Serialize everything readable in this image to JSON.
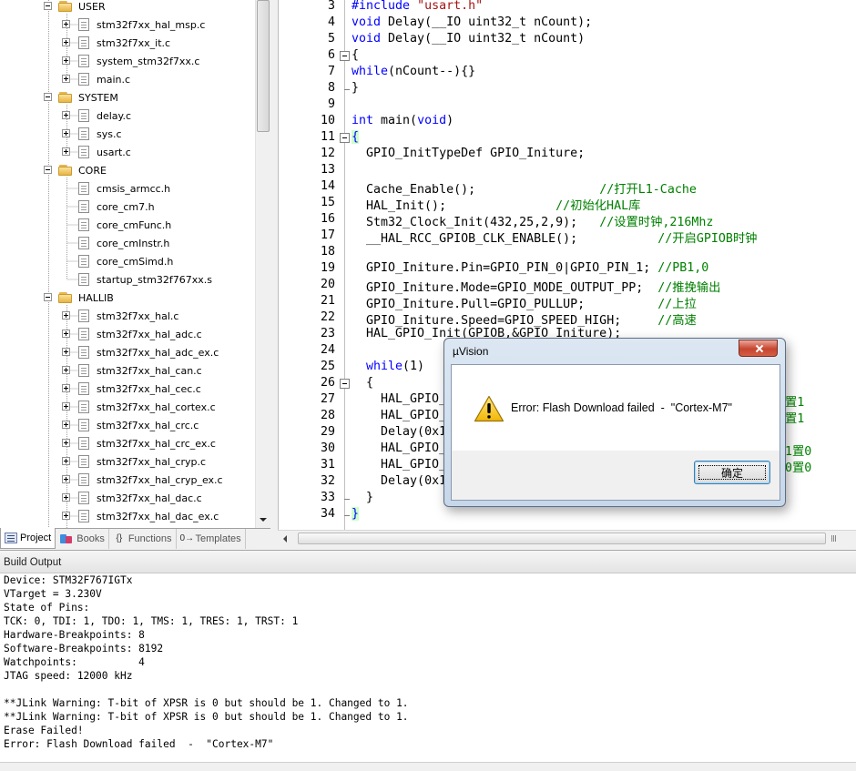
{
  "project_tree": {
    "items": [
      {
        "type": "folder",
        "label": "USER"
      },
      {
        "type": "file",
        "label": "stm32f7xx_hal_msp.c",
        "expandable": true
      },
      {
        "type": "file",
        "label": "stm32f7xx_it.c",
        "expandable": true
      },
      {
        "type": "file",
        "label": "system_stm32f7xx.c",
        "expandable": true
      },
      {
        "type": "file",
        "label": "main.c",
        "expandable": true
      },
      {
        "type": "folder",
        "label": "SYSTEM"
      },
      {
        "type": "file",
        "label": "delay.c",
        "expandable": true
      },
      {
        "type": "file",
        "label": "sys.c",
        "expandable": true
      },
      {
        "type": "file",
        "label": "usart.c",
        "expandable": true
      },
      {
        "type": "folder",
        "label": "CORE"
      },
      {
        "type": "file",
        "label": "cmsis_armcc.h",
        "expandable": false
      },
      {
        "type": "file",
        "label": "core_cm7.h",
        "expandable": false
      },
      {
        "type": "file",
        "label": "core_cmFunc.h",
        "expandable": false
      },
      {
        "type": "file",
        "label": "core_cmInstr.h",
        "expandable": false
      },
      {
        "type": "file",
        "label": "core_cmSimd.h",
        "expandable": false
      },
      {
        "type": "file",
        "label": "startup_stm32f767xx.s",
        "expandable": false
      },
      {
        "type": "folder",
        "label": "HALLIB"
      },
      {
        "type": "file",
        "label": "stm32f7xx_hal.c",
        "expandable": true
      },
      {
        "type": "file",
        "label": "stm32f7xx_hal_adc.c",
        "expandable": true
      },
      {
        "type": "file",
        "label": "stm32f7xx_hal_adc_ex.c",
        "expandable": true
      },
      {
        "type": "file",
        "label": "stm32f7xx_hal_can.c",
        "expandable": true
      },
      {
        "type": "file",
        "label": "stm32f7xx_hal_cec.c",
        "expandable": true
      },
      {
        "type": "file",
        "label": "stm32f7xx_hal_cortex.c",
        "expandable": true
      },
      {
        "type": "file",
        "label": "stm32f7xx_hal_crc.c",
        "expandable": true
      },
      {
        "type": "file",
        "label": "stm32f7xx_hal_crc_ex.c",
        "expandable": true
      },
      {
        "type": "file",
        "label": "stm32f7xx_hal_cryp.c",
        "expandable": true
      },
      {
        "type": "file",
        "label": "stm32f7xx_hal_cryp_ex.c",
        "expandable": true
      },
      {
        "type": "file",
        "label": "stm32f7xx_hal_dac.c",
        "expandable": true
      },
      {
        "type": "file",
        "label": "stm32f7xx_hal_dac_ex.c",
        "expandable": true
      }
    ]
  },
  "panel_tabs": [
    {
      "label": "Project",
      "icon": "project-icon",
      "active": true
    },
    {
      "label": "Books",
      "icon": "books-icon",
      "active": false
    },
    {
      "label": "Functions",
      "icon": "functions-icon",
      "glyph": "{}",
      "active": false
    },
    {
      "label": "Templates",
      "icon": "templates-icon",
      "glyph": "0→",
      "active": false
    }
  ],
  "editor": {
    "lines": [
      {
        "n": "3",
        "code": "#include \"usart.h\""
      },
      {
        "n": "4",
        "code": "void Delay(__IO uint32_t nCount);"
      },
      {
        "n": "5",
        "code": "void Delay(__IO uint32_t nCount)"
      },
      {
        "n": "6",
        "code": "{"
      },
      {
        "n": "7",
        "code": "while(nCount--){}"
      },
      {
        "n": "8",
        "code": "}"
      },
      {
        "n": "9",
        "code": ""
      },
      {
        "n": "10",
        "code": "int main(void)"
      },
      {
        "n": "11",
        "code": "{"
      },
      {
        "n": "12",
        "code": "  GPIO_InitTypeDef GPIO_Initure;"
      },
      {
        "n": "13",
        "code": ""
      },
      {
        "n": "14",
        "code": "  Cache_Enable();                 //打开L1-Cache"
      },
      {
        "n": "15",
        "code": "  HAL_Init();               //初始化HAL库"
      },
      {
        "n": "16",
        "code": "  Stm32_Clock_Init(432,25,2,9);   //设置时钟,216Mhz"
      },
      {
        "n": "17",
        "code": "  __HAL_RCC_GPIOB_CLK_ENABLE();           //开启GPIOB时钟"
      },
      {
        "n": "18",
        "code": ""
      },
      {
        "n": "19",
        "code": "  GPIO_Initure.Pin=GPIO_PIN_0|GPIO_PIN_1; //PB1,0"
      },
      {
        "n": "20",
        "code": "  GPIO_Initure.Mode=GPIO_MODE_OUTPUT_PP;  //推挽输出"
      },
      {
        "n": "21",
        "code": "  GPIO_Initure.Pull=GPIO_PULLUP;          //上拉"
      },
      {
        "n": "22",
        "code": "  GPIO_Initure.Speed=GPIO_SPEED_HIGH;     //高速"
      },
      {
        "n": "23",
        "code": "  HAL_GPIO_Init(GPIOB,&GPIO_Initure);"
      },
      {
        "n": "24",
        "code": ""
      },
      {
        "n": "25",
        "code": "  while(1)"
      },
      {
        "n": "26",
        "code": "  {"
      },
      {
        "n": "27",
        "code": "    HAL_GPIO_"
      },
      {
        "n": "28",
        "code": "    HAL_GPIO_"
      },
      {
        "n": "29",
        "code": "    Delay(0x1"
      },
      {
        "n": "30",
        "code": "    HAL_GPIO_"
      },
      {
        "n": "31",
        "code": "    HAL_GPIO_"
      },
      {
        "n": "32",
        "code": "    Delay(0x1"
      },
      {
        "n": "33",
        "code": "  }"
      },
      {
        "n": "34",
        "code": "}"
      }
    ],
    "occluded_tails": [
      "置1",
      "置1",
      "",
      "1置0",
      "0置0"
    ]
  },
  "build_output": {
    "title": "Build Output",
    "lines": [
      "Device: STM32F767IGTx",
      "VTarget = 3.230V",
      "State of Pins:",
      "TCK: 0, TDI: 1, TDO: 1, TMS: 1, TRES: 1, TRST: 1",
      "Hardware-Breakpoints: 8",
      "Software-Breakpoints: 8192",
      "Watchpoints:          4",
      "JTAG speed: 12000 kHz",
      "",
      "**JLink Warning: T-bit of XPSR is 0 but should be 1. Changed to 1.",
      "**JLink Warning: T-bit of XPSR is 0 but should be 1. Changed to 1.",
      "Erase Failed!",
      "Error: Flash Download failed  -  \"Cortex-M7\""
    ]
  },
  "dialog": {
    "title": "µVision",
    "message": "Error: Flash Download failed  -  \"Cortex-M7\"",
    "ok_label": "确定",
    "icon": "warning-icon"
  },
  "colors": {
    "keyword": "#0000ff",
    "string": "#a31515",
    "comment": "#008000",
    "brace_highlight": "#ccffcc"
  }
}
